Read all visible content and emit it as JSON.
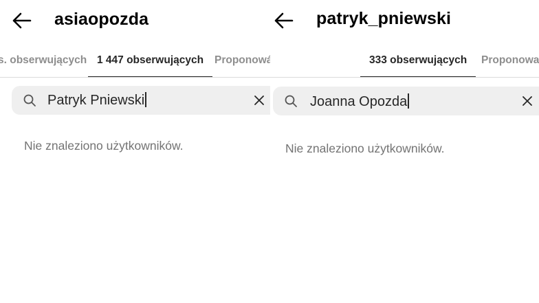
{
  "left": {
    "username": "asiaopozda",
    "tabs": [
      "s. obserwujących",
      "1 447 obserwujących",
      "Proponowá. obserwujących"
    ],
    "search_value": "Patryk Pniewski",
    "empty_message": "Nie znaleziono użytkowników."
  },
  "right": {
    "username": "patryk_pniewski",
    "tabs": [
      "333 obserwujących",
      "Proponowa"
    ],
    "search_value": "Joanna Opozda",
    "empty_message": "Nie znaleziono użytkowników."
  },
  "icons": [
    "back-arrow-icon",
    "search-icon",
    "close-icon"
  ]
}
